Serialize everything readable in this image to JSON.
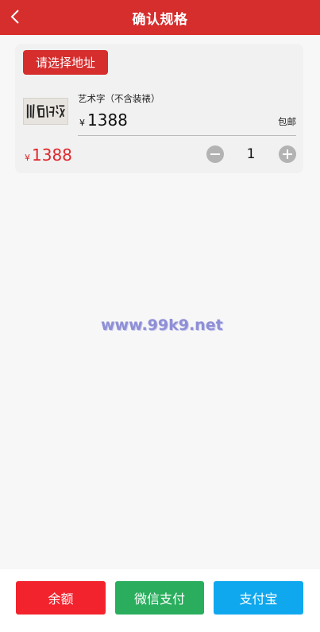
{
  "header": {
    "title": "确认规格",
    "back_icon": "chevron-left-icon"
  },
  "card": {
    "address_button": "请选择地址",
    "product": {
      "name": "艺术字（不含装裱）",
      "currency": "¥",
      "price": "1388",
      "shipping": "包邮",
      "thumbnail_text": "川百纳海"
    },
    "total": {
      "currency": "¥",
      "amount": "1388"
    },
    "quantity": "1"
  },
  "watermark": "www.99k9.net",
  "payment": {
    "balance_label": "余额",
    "wechat_label": "微信支付",
    "alipay_label": "支付宝"
  },
  "colors": {
    "brand_red": "#d62d2d",
    "price_red": "#e0262b",
    "wechat_green": "#2aae5e",
    "alipay_blue": "#0fa8ee",
    "watermark": "#8f8fd6"
  }
}
